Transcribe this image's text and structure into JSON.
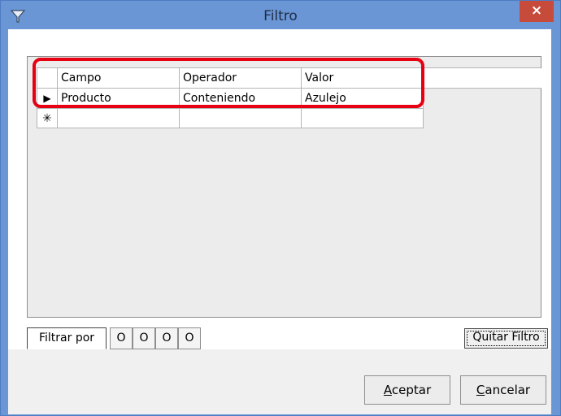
{
  "window": {
    "title": "Filtro",
    "close_label": "×"
  },
  "grid": {
    "columns": [
      "Campo",
      "Operador",
      "Valor"
    ],
    "rows": [
      {
        "indicator": "▶",
        "campo": "Producto",
        "operador": "Conteniendo",
        "valor": "Azulejo"
      },
      {
        "indicator": "✳",
        "campo": "",
        "operador": "",
        "valor": ""
      }
    ]
  },
  "tabs": {
    "filter_by": "Filtrar por",
    "or_tabs": [
      "O",
      "O",
      "O",
      "O"
    ]
  },
  "buttons": {
    "remove_filter": "Quitar Filtro",
    "accept_first": "A",
    "accept_rest": "ceptar",
    "cancel_first": "C",
    "cancel_rest": "ancelar"
  },
  "colors": {
    "titlebar": "#6a96d6",
    "close": "#c74b3a",
    "highlight": "#e60012"
  }
}
